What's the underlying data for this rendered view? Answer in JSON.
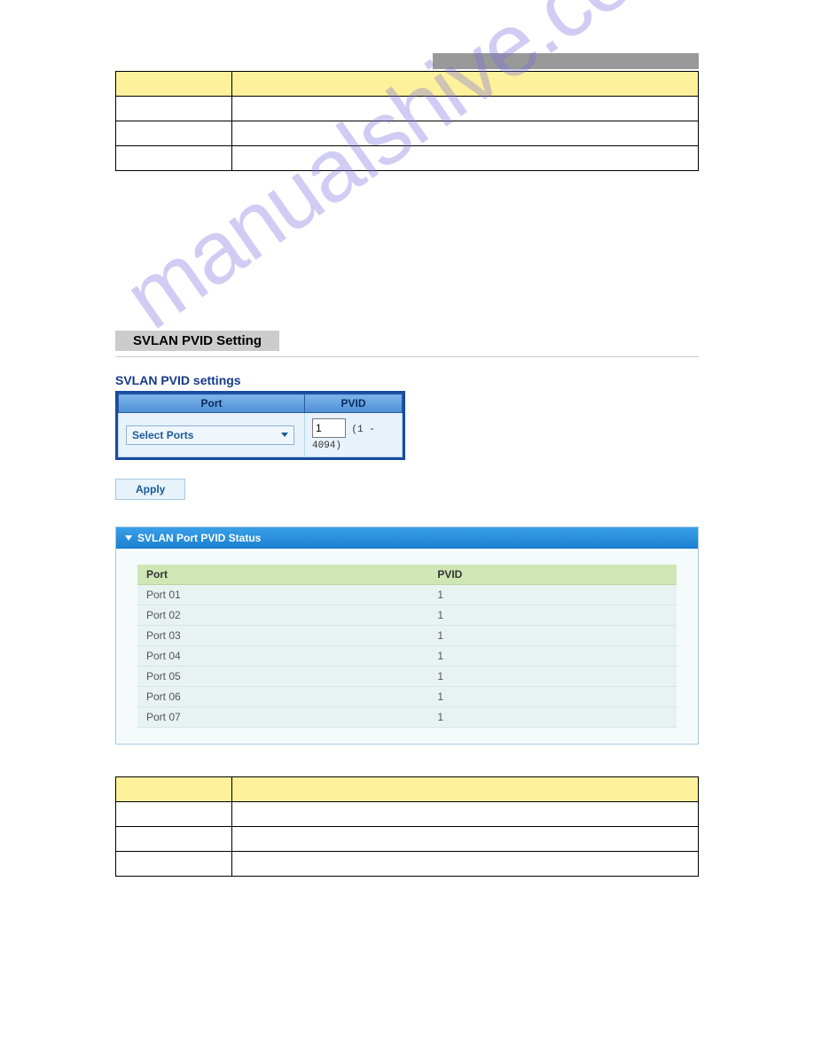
{
  "watermark": "manualshive.com",
  "desc_table_1": {
    "headers": [
      "",
      ""
    ],
    "rows": [
      [
        "",
        ""
      ],
      [
        "",
        ""
      ],
      [
        "",
        ""
      ]
    ]
  },
  "svlan": {
    "title_bar": "SVLAN PVID Setting",
    "settings_title": "SVLAN PVID settings",
    "table": {
      "port_header": "Port",
      "pvid_header": "PVID",
      "dropdown_label": "Select Ports",
      "input_value": "1",
      "range_text": "(1 - 4094)"
    },
    "apply_label": "Apply"
  },
  "status": {
    "panel_title": "SVLAN Port PVID Status",
    "headers": {
      "port": "Port",
      "pvid": "PVID"
    },
    "rows": [
      {
        "port": "Port 01",
        "pvid": "1"
      },
      {
        "port": "Port 02",
        "pvid": "1"
      },
      {
        "port": "Port 03",
        "pvid": "1"
      },
      {
        "port": "Port 04",
        "pvid": "1"
      },
      {
        "port": "Port 05",
        "pvid": "1"
      },
      {
        "port": "Port 06",
        "pvid": "1"
      },
      {
        "port": "Port 07",
        "pvid": "1"
      }
    ]
  },
  "desc_table_2": {
    "headers": [
      "",
      ""
    ],
    "rows": [
      [
        "",
        ""
      ],
      [
        "",
        ""
      ],
      [
        "",
        ""
      ]
    ]
  }
}
